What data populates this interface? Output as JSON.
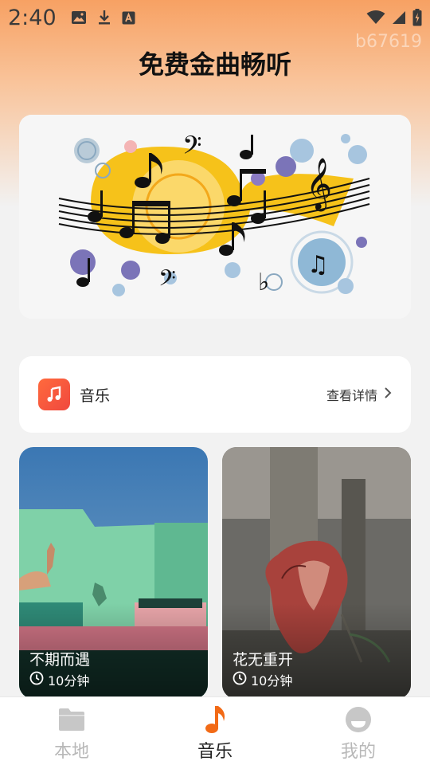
{
  "status_bar": {
    "time": "2:40",
    "left_icons": [
      "image-icon",
      "download-icon",
      "a-badge-icon"
    ],
    "right_icons": [
      "wifi-icon",
      "signal-icon",
      "battery-charging-icon"
    ]
  },
  "watermark": "b67619",
  "header": {
    "title": "免费金曲畅听"
  },
  "banner": {
    "image": "music-notes-illustration"
  },
  "section": {
    "icon": "music-note-app-icon",
    "label": "音乐",
    "more_label": "查看详情",
    "more_icon": "chevron-right-icon"
  },
  "songs": [
    {
      "title": "不期而遇",
      "duration": "10分钟",
      "image": "green-wall-hand-shadow"
    },
    {
      "title": "花无重开",
      "duration": "10分钟",
      "image": "dried-rose"
    }
  ],
  "bottom_nav": {
    "items": [
      {
        "label": "本地",
        "icon": "folder-icon",
        "active": false
      },
      {
        "label": "音乐",
        "icon": "music-note-icon",
        "active": true
      },
      {
        "label": "我的",
        "icon": "profile-icon",
        "active": false
      }
    ]
  },
  "colors": {
    "accent": "#f26a16",
    "header_gradient_top": "#f7a163",
    "inactive_nav": "#b8b8b8"
  }
}
